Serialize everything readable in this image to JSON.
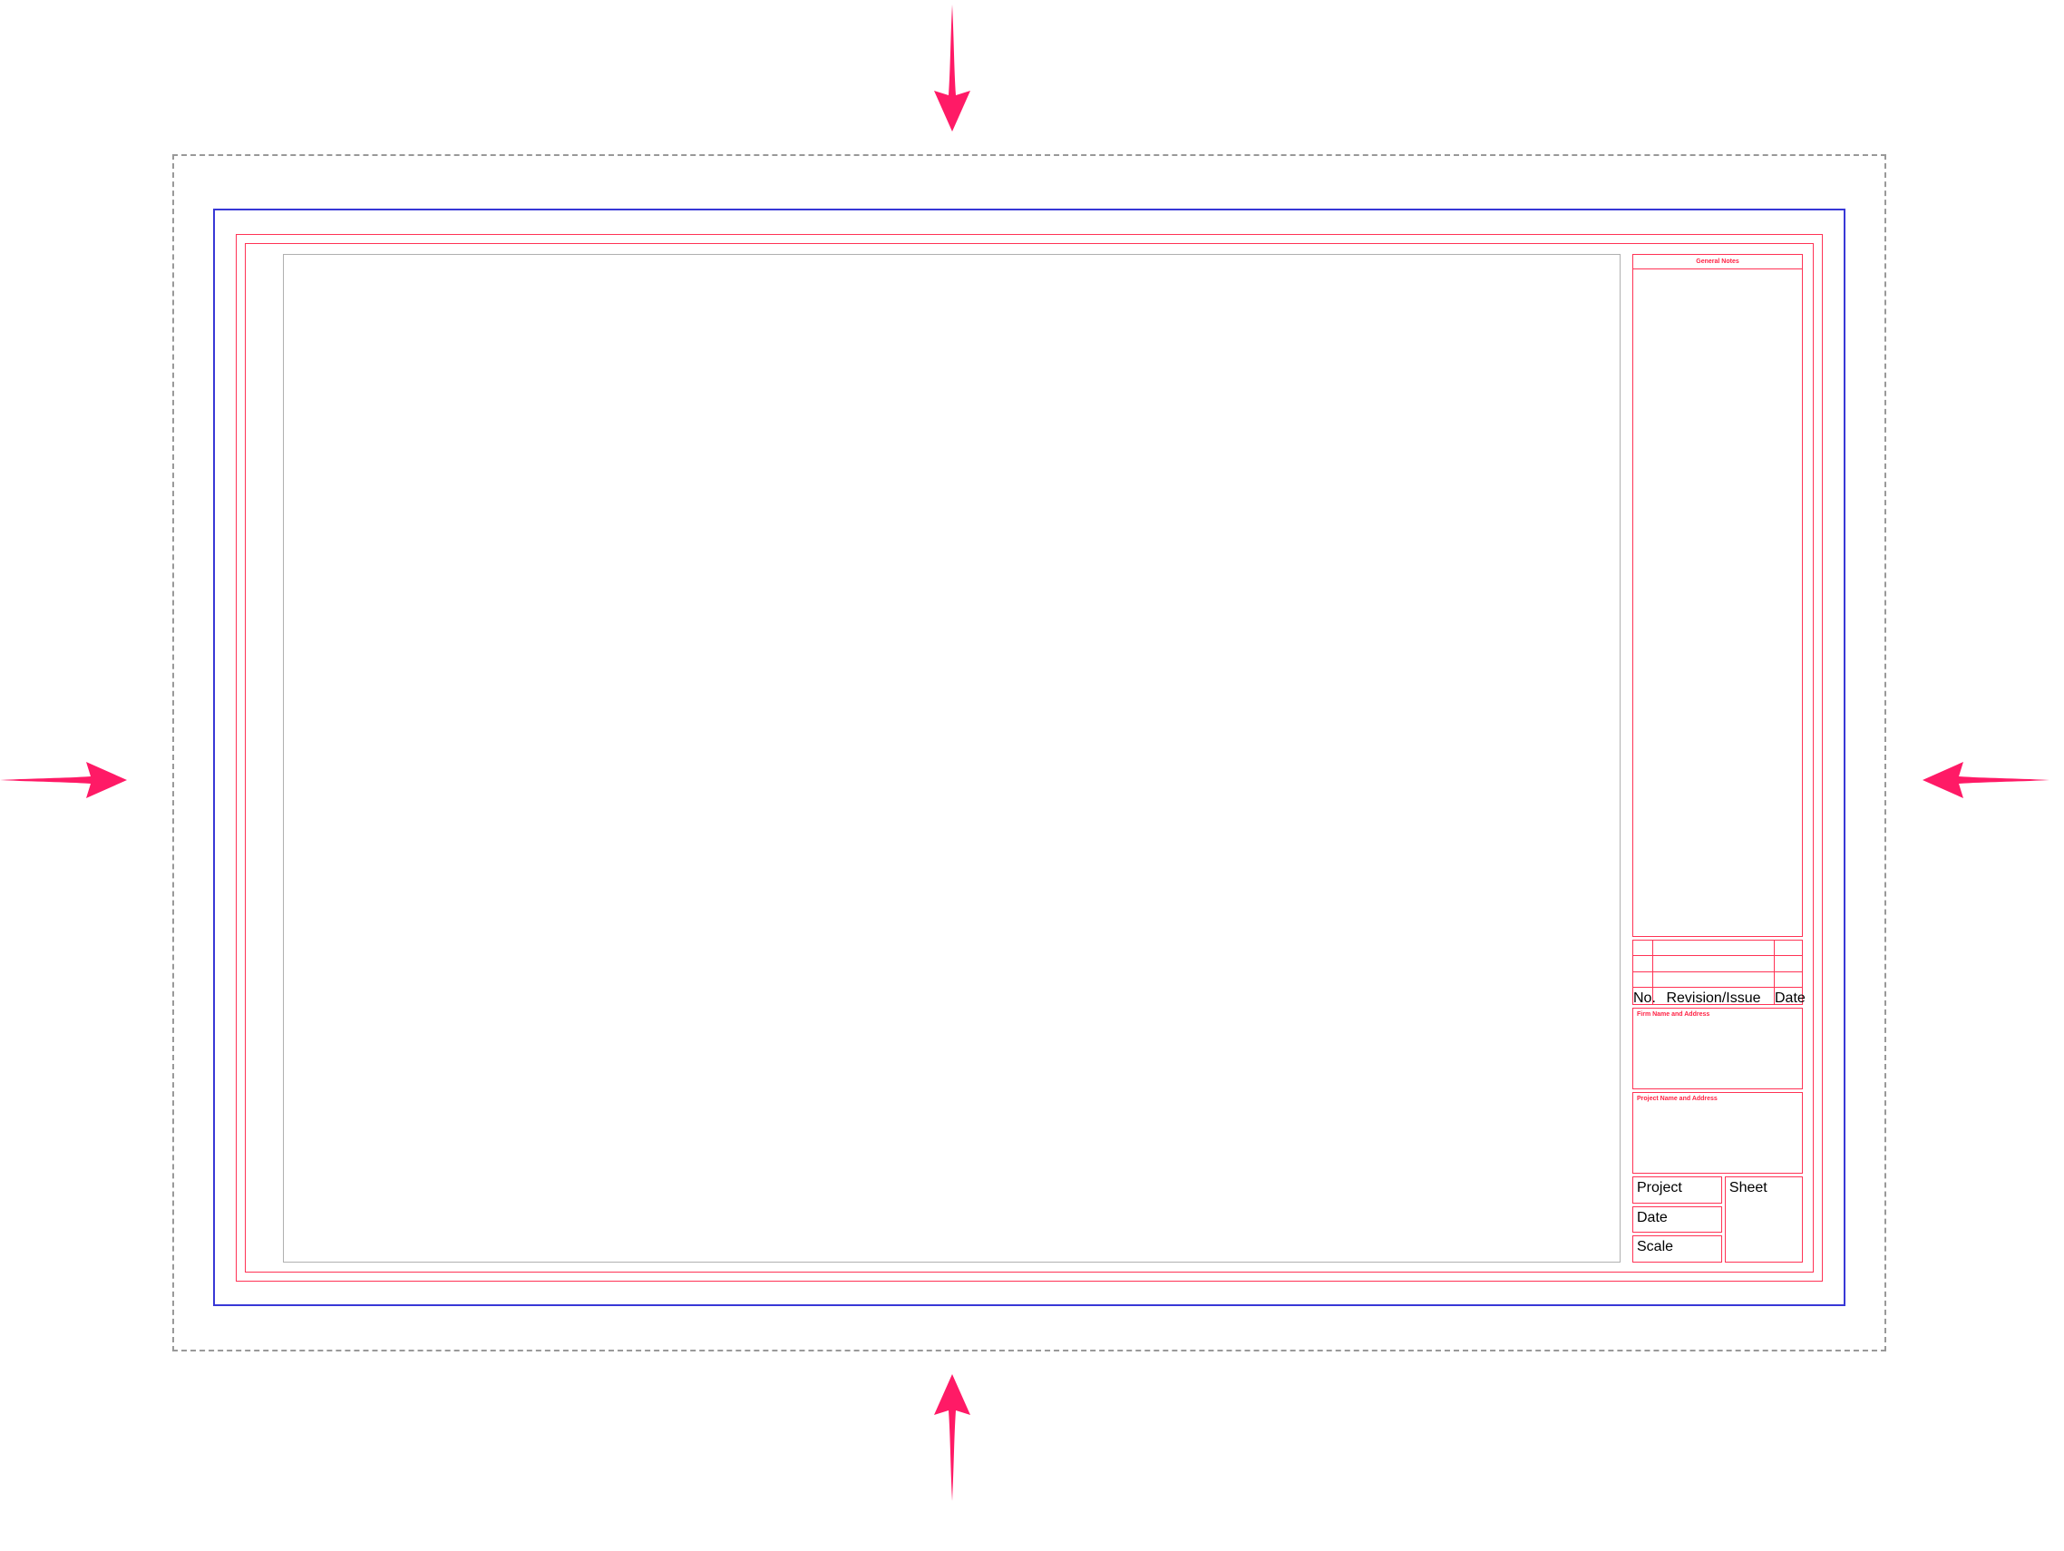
{
  "colors": {
    "arrow": "#ff1a66",
    "blue_border": "#3838d6",
    "red_line": "#ff3355",
    "dashed": "#999999"
  },
  "titleblock": {
    "general_notes_header": "General Notes",
    "revision": {
      "col_no": "No.",
      "col_desc": "Revision/Issue",
      "col_date": "Date"
    },
    "firm_label": "Firm Name and Address",
    "project_label": "Project Name and Address",
    "project_field": "Project",
    "sheet_field": "Sheet",
    "date_field": "Date",
    "scale_field": "Scale"
  }
}
